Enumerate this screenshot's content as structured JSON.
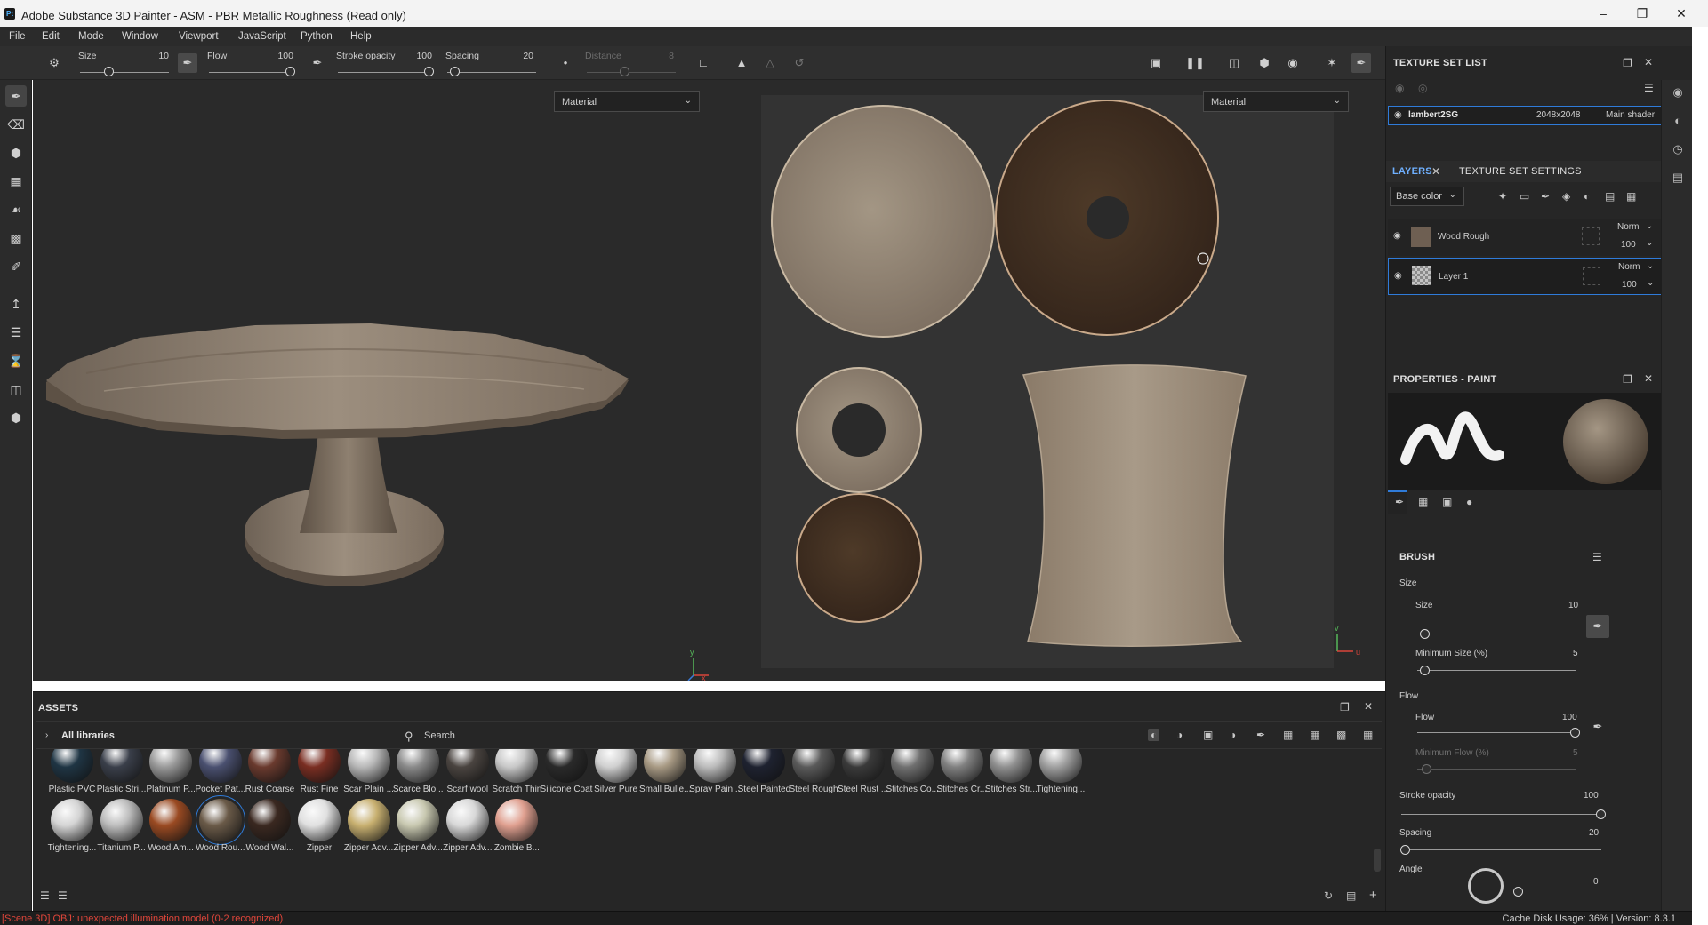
{
  "window": {
    "title": "Adobe Substance 3D Painter - ASM - PBR Metallic Roughness (Read only)",
    "icon_text": "Pt",
    "controls": [
      "minimize-icon",
      "maximize-icon",
      "close-icon"
    ]
  },
  "menu": [
    "File",
    "Edit",
    "Mode",
    "Window",
    "Viewport",
    "JavaScript",
    "Python",
    "Help"
  ],
  "tool_options": {
    "size_label": "Size",
    "size_value": "10",
    "flow_label": "Flow",
    "flow_value": "100",
    "stroke_opacity_label": "Stroke opacity",
    "stroke_opacity_value": "100",
    "spacing_label": "Spacing",
    "spacing_value": "20",
    "distance_label": "Distance",
    "distance_value": "8"
  },
  "viewport_3d": {
    "mode_dropdown": "Material",
    "axes": [
      "y",
      "x"
    ]
  },
  "viewport_2d": {
    "mode_dropdown": "Material",
    "axes": [
      "v",
      "u"
    ]
  },
  "texture_set_list": {
    "header": "TEXTURE SET LIST",
    "item": {
      "name": "lambert2SG",
      "resolution": "2048x2048",
      "shader": "Main shader"
    }
  },
  "layers_panel": {
    "tabs": [
      "LAYERS",
      "TEXTURE SET SETTINGS"
    ],
    "channel_dropdown": "Base color",
    "layers": [
      {
        "name": "Wood Rough",
        "blend": "Norm",
        "opacity": "100"
      },
      {
        "name": "Layer 1",
        "blend": "Norm",
        "opacity": "100"
      }
    ]
  },
  "properties": {
    "header": "PROPERTIES - PAINT",
    "brush_section": "BRUSH",
    "size_group": "Size",
    "size_label": "Size",
    "size_value": "10",
    "size_level": 0.05,
    "min_size_label": "Minimum Size (%)",
    "min_size_value": "5",
    "min_size_level": 0.05,
    "flow_group": "Flow",
    "flow_label": "Flow",
    "flow_value": "100",
    "flow_level": 1.0,
    "min_flow_label": "Minimum Flow (%)",
    "min_flow_value": "5",
    "stroke_opacity_label": "Stroke opacity",
    "stroke_opacity_value": "100",
    "stroke_opacity_level": 1.0,
    "spacing_label": "Spacing",
    "spacing_value": "20",
    "spacing_level": 0.02,
    "angle_label": "Angle",
    "angle_value": "0"
  },
  "assets": {
    "header": "ASSETS",
    "library": "All libraries",
    "search_placeholder": "Search",
    "row1": [
      "Plastic PVC",
      "Plastic Stri...",
      "Platinum P...",
      "Pocket Pat...",
      "Rust Coarse",
      "Rust Fine",
      "Scar Plain ...",
      "Scarce Blo...",
      "Scarf wool",
      "Scratch Thin",
      "Silicone Coat",
      "Silver Pure",
      "Small Bulle...",
      "Spray Pain...",
      "Steel Painted",
      "Steel Rough",
      "Steel Rust ...",
      "Stitches Co...",
      "Stitches Cr...",
      "Stitches Str...",
      "Tightening..."
    ],
    "row2": [
      "Tightening...",
      "Titanium P...",
      "Wood Am...",
      "Wood Rou...",
      "Wood Wal...",
      "Zipper",
      "Zipper Adv...",
      "Zipper Adv...",
      "Zipper Adv...",
      "Zombie B..."
    ],
    "selected": "Wood Rou..."
  },
  "status": {
    "error": "[Scene 3D] OBJ: unexpected illumination model (0-2 recognized)",
    "cache": "Cache Disk Usage:   36% | Version: 8.3.1"
  }
}
